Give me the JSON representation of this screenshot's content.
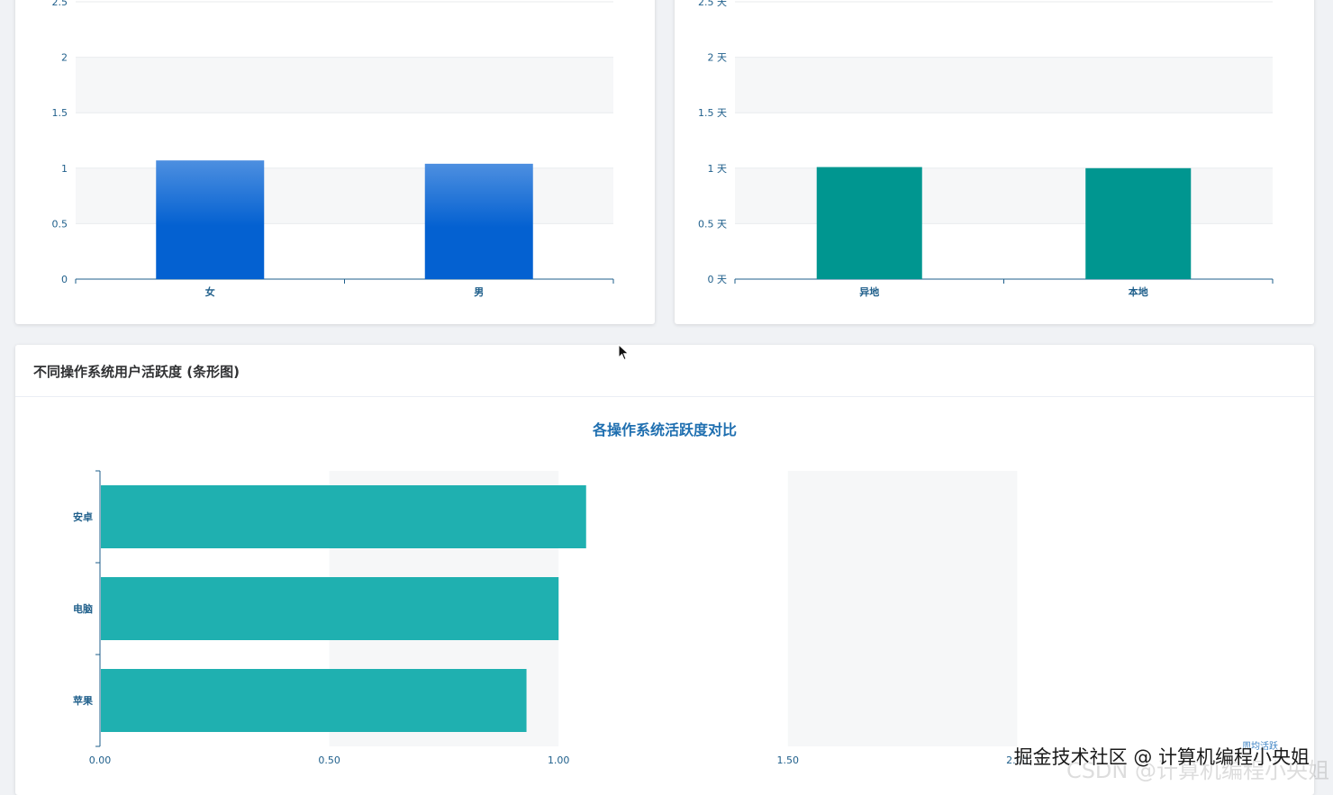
{
  "panels": {
    "os_title": "不同操作系统用户活跃度 (条形图)"
  },
  "colors": {
    "gender_bar_top": "#4d8fe0",
    "gender_bar_bottom": "#0461d1",
    "location_bar": "#009690",
    "os_bar": "#1fb0b0",
    "axis": "#1f5f8b"
  },
  "chart_data": [
    {
      "type": "bar",
      "categories": [
        "女",
        "男"
      ],
      "values": [
        1.07,
        1.04
      ],
      "ylim": [
        0,
        2.5
      ],
      "yticks": [
        "0",
        "0.5",
        "1",
        "1.5",
        "2",
        "2.5"
      ],
      "grid": "alternating bands"
    },
    {
      "type": "bar",
      "categories": [
        "异地",
        "本地"
      ],
      "values": [
        1.01,
        1.0
      ],
      "ylim": [
        0,
        2.5
      ],
      "yticks": [
        "0 天",
        "0.5 天",
        "1 天",
        "1.5 天",
        "2 天",
        "2.5 天"
      ],
      "grid": "alternating bands"
    },
    {
      "type": "bar",
      "orientation": "horizontal",
      "title": "各操作系统活跃度对比",
      "categories": [
        "安卓",
        "电脑",
        "苹果"
      ],
      "values": [
        1.06,
        1.0,
        0.93
      ],
      "xlim": [
        0,
        2.5
      ],
      "xticks": [
        "0.00",
        "0.50",
        "1.00",
        "1.50",
        "2.00"
      ],
      "legend": "周均活跃",
      "legend_position": "bottom-right"
    }
  ],
  "watermark": {
    "line1": "掘金技术社区 @ 计算机编程小央姐",
    "line2": "CSDN @计算机编程小央姐"
  }
}
